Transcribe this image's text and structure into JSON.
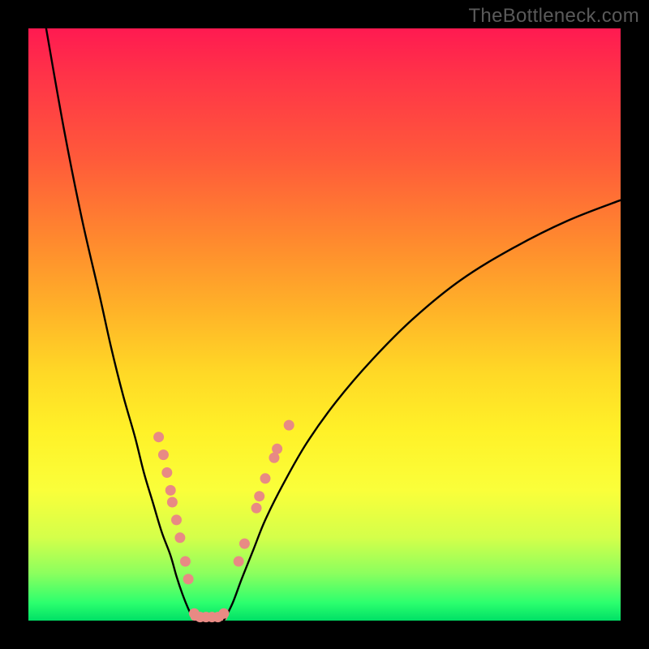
{
  "watermark": "TheBottleneck.com",
  "chart_data": {
    "type": "line",
    "title": "",
    "xlabel": "",
    "ylabel": "",
    "xlim": [
      0,
      100
    ],
    "ylim": [
      0,
      100
    ],
    "note": "No numeric axes or tick labels are visible; x/y values are normalized 0–100 positions read from the figure pixels.",
    "series": [
      {
        "name": "left-curve",
        "x": [
          3,
          6,
          9,
          12,
          14,
          16,
          18,
          19.5,
          21,
          22.5,
          24,
          25,
          26,
          27,
          28
        ],
        "y": [
          100,
          83,
          68,
          55,
          46,
          38,
          31,
          25,
          20,
          15,
          11,
          7.5,
          4.5,
          2,
          0
        ]
      },
      {
        "name": "valley-floor",
        "x": [
          28,
          29,
          30,
          31,
          32,
          33
        ],
        "y": [
          0,
          0,
          0,
          0,
          0,
          0
        ]
      },
      {
        "name": "right-curve",
        "x": [
          33,
          34.5,
          36,
          38,
          40,
          43,
          47,
          52,
          58,
          65,
          73,
          82,
          91,
          100
        ],
        "y": [
          0,
          3,
          7,
          12,
          17,
          23,
          30,
          37,
          44,
          51,
          57.5,
          63,
          67.5,
          71
        ]
      }
    ],
    "markers": {
      "name": "highlighted-points",
      "color": "#e88a84",
      "points": [
        {
          "x": 22.0,
          "y": 31.0
        },
        {
          "x": 22.8,
          "y": 28.0
        },
        {
          "x": 23.4,
          "y": 25.0
        },
        {
          "x": 24.0,
          "y": 22.0
        },
        {
          "x": 24.3,
          "y": 20.0
        },
        {
          "x": 25.0,
          "y": 17.0
        },
        {
          "x": 25.6,
          "y": 14.0
        },
        {
          "x": 26.5,
          "y": 10.0
        },
        {
          "x": 27.0,
          "y": 7.0
        },
        {
          "x": 28.0,
          "y": 1.2
        },
        {
          "x": 29.0,
          "y": 0.6
        },
        {
          "x": 30.0,
          "y": 0.6
        },
        {
          "x": 31.0,
          "y": 0.6
        },
        {
          "x": 32.0,
          "y": 0.6
        },
        {
          "x": 33.0,
          "y": 1.2
        },
        {
          "x": 35.5,
          "y": 10.0
        },
        {
          "x": 36.5,
          "y": 13.0
        },
        {
          "x": 38.5,
          "y": 19.0
        },
        {
          "x": 39.0,
          "y": 21.0
        },
        {
          "x": 40.0,
          "y": 24.0
        },
        {
          "x": 41.5,
          "y": 27.5
        },
        {
          "x": 42.0,
          "y": 29.0
        },
        {
          "x": 44.0,
          "y": 33.0
        }
      ]
    }
  }
}
